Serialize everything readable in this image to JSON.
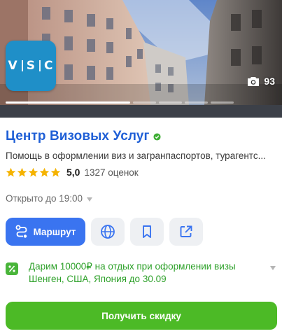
{
  "hero": {
    "logo_text": "VSC",
    "photo_count": "93",
    "photo_index": 1,
    "photo_segments": 6
  },
  "place": {
    "title": "Центр Визовых Услуг",
    "subtitle": "Помощь в оформлении виз и загранпаспортов, турагентс...",
    "rating": "5,0",
    "reviews": "1327 оценок",
    "hours": "Открыто до 19:00"
  },
  "actions": {
    "route_label": "Маршрут"
  },
  "promo": {
    "text": "Дарим 10000₽ на отдых при оформлении визы Шенген, США, Япония до 30.09"
  },
  "cta": {
    "label": "Получить скидку"
  },
  "colors": {
    "title_blue": "#1f5fd6",
    "route_blue": "#3a74f0",
    "promo_green": "#2ea12a",
    "cta_green": "#4cba26",
    "star_gold": "#f5b301",
    "logo_blue": "#1f8fc8"
  }
}
